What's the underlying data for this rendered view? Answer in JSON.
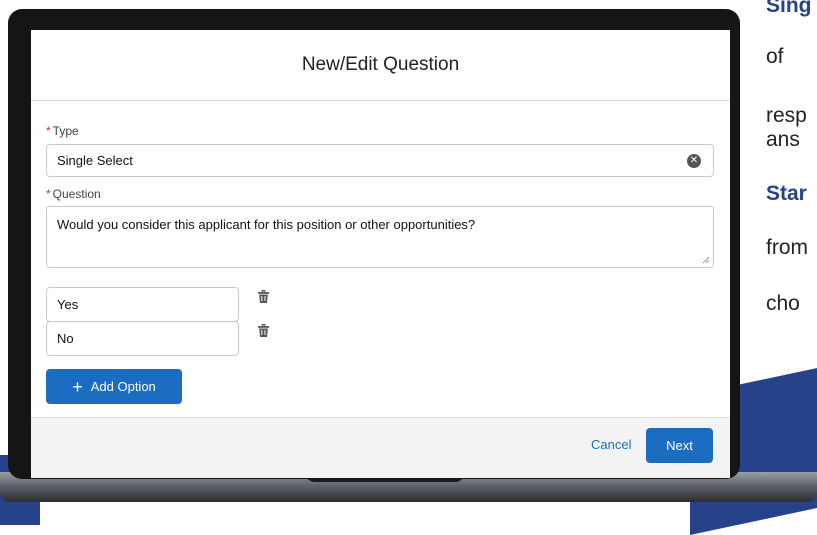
{
  "side_copy": [
    "Sing",
    "of",
    "resp",
    "ans",
    "Star",
    "from",
    "cho"
  ],
  "modal": {
    "title": "New/Edit Question",
    "type_label": "Type",
    "type_value": "Single Select",
    "question_label": "Question",
    "question_value": "Would you consider this applicant for this position or other opportunities?",
    "options": [
      "Yes",
      "No"
    ],
    "add_option_label": "Add Option",
    "cancel_label": "Cancel",
    "next_label": "Next"
  },
  "colors": {
    "accent": "#1b6dc1",
    "required": "#c23934",
    "brand": "#26428b"
  }
}
